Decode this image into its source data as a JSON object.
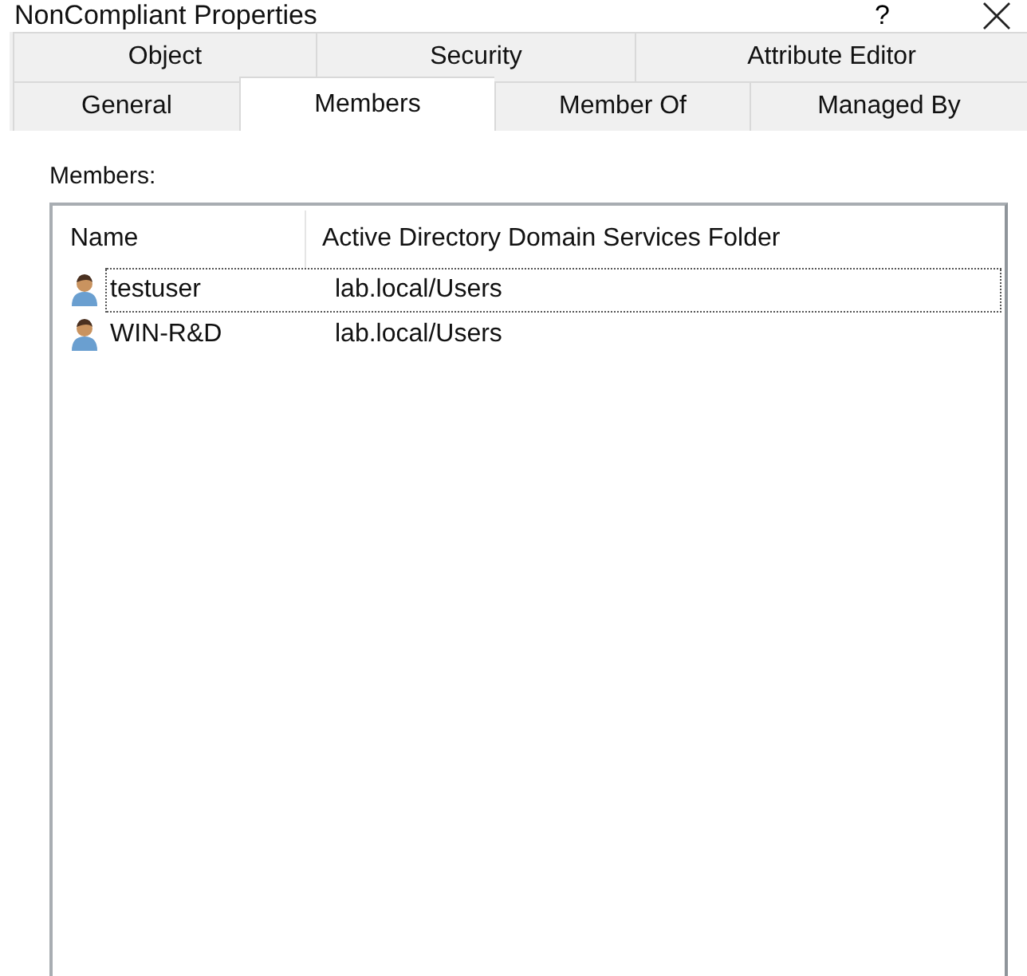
{
  "window": {
    "title": "NonCompliant Properties",
    "help": "?"
  },
  "tab_rows": [
    [
      {
        "label": "Object",
        "selected": false
      },
      {
        "label": "Security",
        "selected": false
      },
      {
        "label": "Attribute Editor",
        "selected": false
      }
    ],
    [
      {
        "label": "General",
        "selected": false
      },
      {
        "label": "Members",
        "selected": true
      },
      {
        "label": "Member Of",
        "selected": false
      },
      {
        "label": "Managed By",
        "selected": false
      }
    ]
  ],
  "members": {
    "label": "Members:",
    "columns": [
      "Name",
      "Active Directory Domain Services Folder"
    ],
    "rows": [
      {
        "name": "testuser",
        "folder": "lab.local/Users",
        "focused": true
      },
      {
        "name": "WIN-R&D",
        "folder": "lab.local/Users",
        "focused": false
      }
    ]
  }
}
